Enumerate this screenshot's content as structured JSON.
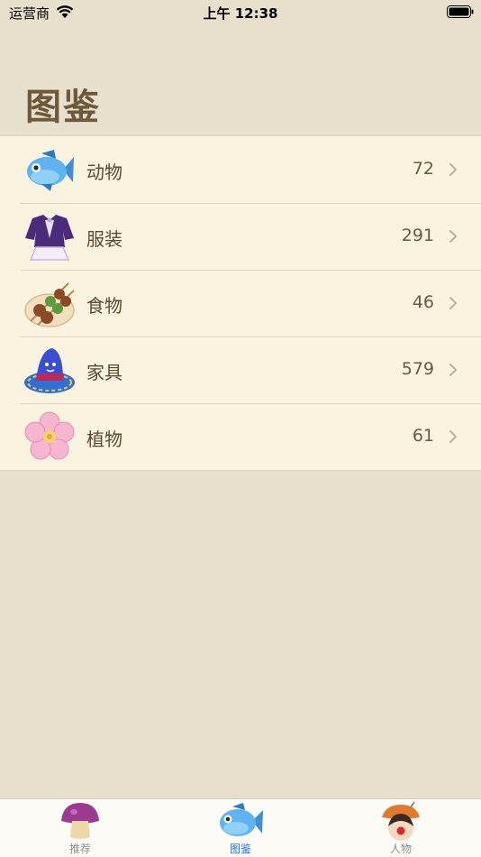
{
  "status_bar": {
    "carrier": "运营商",
    "time": "上午 12:38"
  },
  "header": {
    "title": "图鉴"
  },
  "list": {
    "items": [
      {
        "label": "动物",
        "count": "72",
        "icon": "fish-icon"
      },
      {
        "label": "服装",
        "count": "291",
        "icon": "dress-icon"
      },
      {
        "label": "食物",
        "count": "46",
        "icon": "skewers-icon"
      },
      {
        "label": "家具",
        "count": "579",
        "icon": "hat-icon"
      },
      {
        "label": "植物",
        "count": "61",
        "icon": "flower-icon"
      }
    ]
  },
  "tab_bar": {
    "tabs": [
      {
        "label": "推荐",
        "icon": "mushroom-icon",
        "active": false
      },
      {
        "label": "图鉴",
        "icon": "fish-icon",
        "active": true
      },
      {
        "label": "人物",
        "icon": "character-icon",
        "active": false
      }
    ]
  },
  "colors": {
    "accent": "#1a73e8",
    "title": "#6e5a3a",
    "list_bg": "#faf3df",
    "page_bg": "#e6e0cd"
  }
}
